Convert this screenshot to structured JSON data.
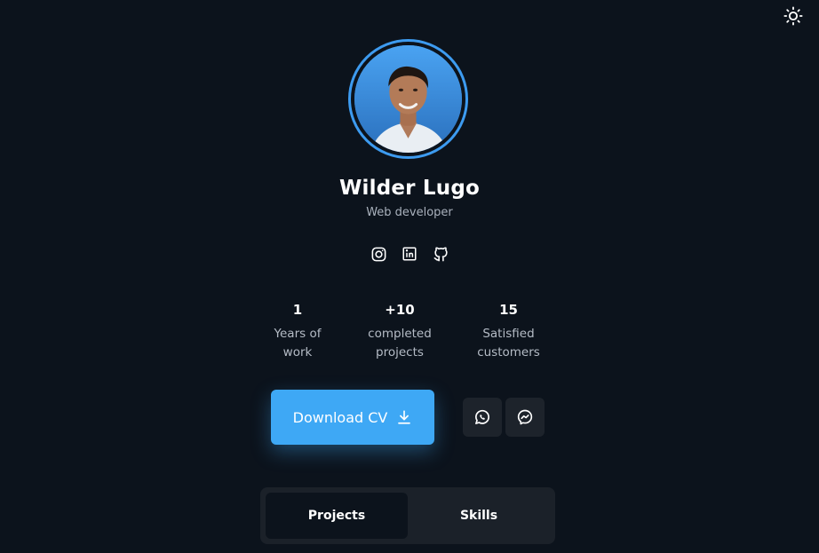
{
  "profile": {
    "name": "Wilder Lugo",
    "role": "Web developer"
  },
  "socials": [
    "instagram-icon",
    "linkedin-icon",
    "github-icon"
  ],
  "stats": [
    {
      "value": "1",
      "label_line1": "Years of",
      "label_line2": "work"
    },
    {
      "value": "+10",
      "label_line1": "completed",
      "label_line2": "projects"
    },
    {
      "value": "15",
      "label_line1": "Satisfied",
      "label_line2": "customers"
    }
  ],
  "actions": {
    "download_label": "Download CV",
    "contact_icons": [
      "whatsapp-icon",
      "messenger-icon"
    ]
  },
  "tabs": [
    {
      "label": "Projects",
      "active": true
    },
    {
      "label": "Skills",
      "active": false
    }
  ],
  "colors": {
    "background": "#0c131c",
    "accent": "#3ea8f5",
    "ring": "#3d9bf0",
    "surface": "#1b2129"
  }
}
